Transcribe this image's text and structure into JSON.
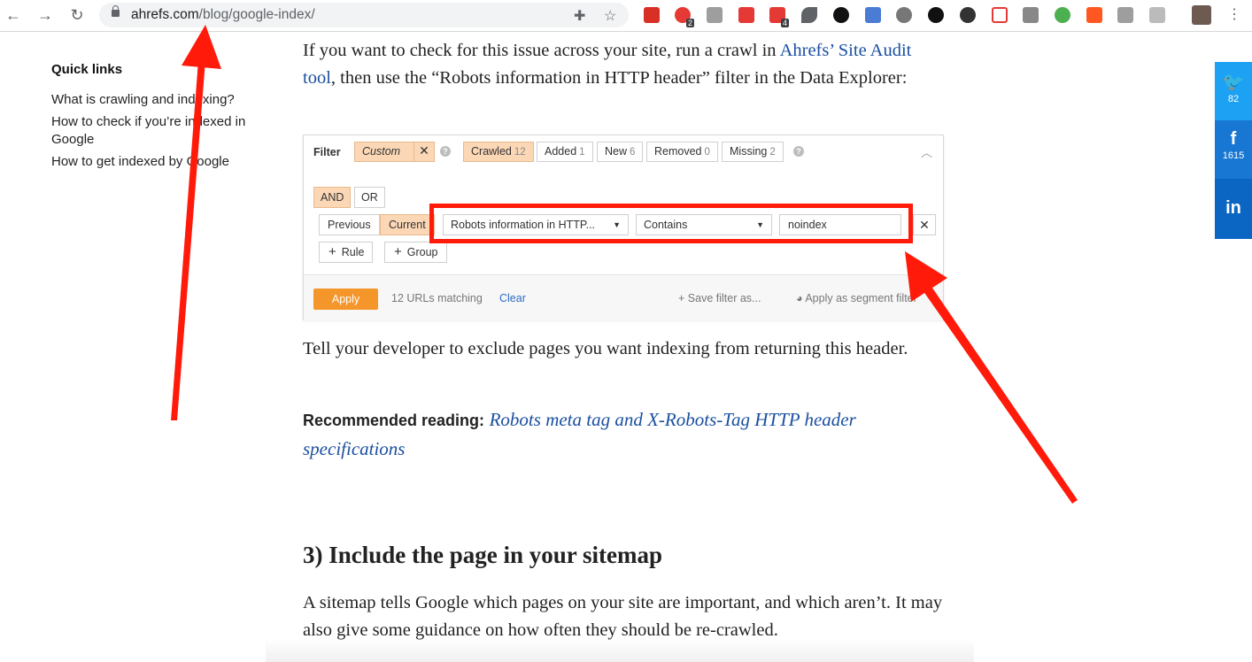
{
  "browser": {
    "url_host": "ahrefs.com",
    "url_path": "/blog/google-index/",
    "ext_badges": [
      "2",
      "4"
    ]
  },
  "sidebar": {
    "title": "Quick links",
    "items": [
      {
        "label": "What is crawling and indexing?"
      },
      {
        "label": "How to check if you’re indexed in Google"
      },
      {
        "label": "How to get indexed by Google"
      }
    ]
  },
  "article": {
    "p1_before": "If you want to check for this issue across your site, run a crawl in ",
    "p1_link": "Ahrefs’ Site Audit tool",
    "p1_after": ", then use the “Robots information in HTTP header” filter in the Data Explorer:",
    "p2": "Tell your developer to exclude pages you want indexing from returning this header.",
    "rec_label": "Recommended reading:",
    "rec_link": "Robots meta tag and X-Robots-Tag HTTP header specifications",
    "heading": "3) Include the page in your sitemap",
    "p3": "A sitemap tells Google which pages on your site are important, and which aren’t. It may also give some guidance on how often they should be re-crawled."
  },
  "filter_panel": {
    "filter_label": "Filter",
    "custom_label": "Custom",
    "close_glyph": "✕",
    "help_glyph": "?",
    "tabs": [
      {
        "label": "Crawled",
        "count": "12"
      },
      {
        "label": "Added",
        "count": "1"
      },
      {
        "label": "New",
        "count": "6"
      },
      {
        "label": "Removed",
        "count": "0"
      },
      {
        "label": "Missing",
        "count": "2"
      }
    ],
    "and_label": "AND",
    "or_label": "OR",
    "previous_label": "Previous",
    "current_label": "Current",
    "field_select": "Robots information in HTTP...",
    "operator_select": "Contains",
    "value_input": "noindex",
    "rule_label": "Rule",
    "group_label": "Group",
    "apply_label": "Apply",
    "match_text": "12 URLs matching",
    "clear_label": "Clear",
    "save_label": "Save filter as...",
    "segment_label": "Apply as segment filter"
  },
  "share": {
    "twitter_count": "82",
    "facebook_count": "1615"
  },
  "colors": {
    "accent_orange": "#f5962a",
    "highlight_red": "#ff1a0a",
    "link_blue": "#1a4fa0",
    "twitter": "#1da1f2",
    "facebook": "#1877d2",
    "linkedin": "#0a66c2"
  }
}
